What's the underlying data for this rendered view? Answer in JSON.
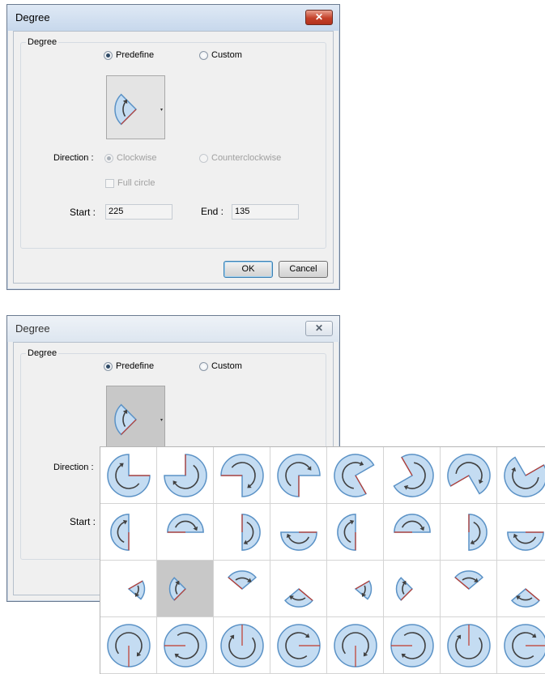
{
  "dialog1": {
    "title": "Degree",
    "close_glyph": "✕",
    "group_label": "Degree",
    "mode_options": [
      {
        "label": "Predefine",
        "checked": true
      },
      {
        "label": "Custom",
        "checked": false
      }
    ],
    "direction_label": "Direction :",
    "direction_options": [
      {
        "label": "Clockwise",
        "checked": true,
        "disabled": true
      },
      {
        "label": "Counterclockwise",
        "checked": false,
        "disabled": true
      }
    ],
    "full_circle_label": "Full circle",
    "start_label": "Start :",
    "start_value": "225",
    "end_label": "End :",
    "end_value": "135",
    "ok_label": "OK",
    "cancel_label": "Cancel",
    "dropdown_arrow": "▾"
  },
  "dialog2": {
    "title": "Degree",
    "close_glyph": "✕",
    "group_label": "Degree",
    "mode_options": [
      {
        "label": "Predefine",
        "checked": true
      },
      {
        "label": "Custom",
        "checked": false
      }
    ],
    "direction_label": "Direction :",
    "start_label": "Start :",
    "dropdown_arrow": "▾"
  },
  "presets": {
    "selected_index": 17,
    "items": [
      {
        "start": 0,
        "end": 90
      },
      {
        "start": 90,
        "end": 180
      },
      {
        "start": 180,
        "end": 270
      },
      {
        "start": 270,
        "end": 360
      },
      {
        "start": 300,
        "end": 30
      },
      {
        "start": 120,
        "end": 210
      },
      {
        "start": 210,
        "end": 300
      },
      {
        "start": 30,
        "end": 120
      },
      {
        "start": 270,
        "end": 90
      },
      {
        "start": 180,
        "end": 360
      },
      {
        "start": 90,
        "end": 270
      },
      {
        "start": 0,
        "end": 180
      },
      {
        "start": 270,
        "end": 90
      },
      {
        "start": 180,
        "end": 360
      },
      {
        "start": 90,
        "end": 270
      },
      {
        "start": 0,
        "end": 180
      },
      {
        "start": 30,
        "end": 320
      },
      {
        "start": 225,
        "end": 135
      },
      {
        "start": 140,
        "end": 40
      },
      {
        "start": 320,
        "end": 220
      },
      {
        "start": 30,
        "end": 320
      },
      {
        "start": 225,
        "end": 135
      },
      {
        "start": 140,
        "end": 40
      },
      {
        "start": 320,
        "end": 220
      },
      {
        "start": 270,
        "end": 270
      },
      {
        "start": 180,
        "end": 180
      },
      {
        "start": 90,
        "end": 90
      },
      {
        "start": 0,
        "end": 0
      },
      {
        "start": 270,
        "end": 270
      },
      {
        "start": 180,
        "end": 180
      },
      {
        "start": 90,
        "end": 90
      },
      {
        "start": 0,
        "end": 0
      }
    ]
  },
  "colors": {
    "sector_fill": "#c4dcf2",
    "sector_stroke": "#5b92c6",
    "arrow": "#404040",
    "radius_line": "#c0392b"
  },
  "icons": [
    "close-icon",
    "dropdown-arrow-icon",
    "sector-icon"
  ]
}
